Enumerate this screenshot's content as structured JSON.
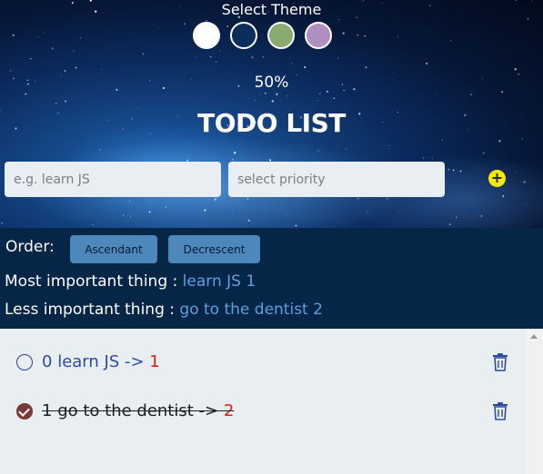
{
  "theme": {
    "title": "Select Theme",
    "swatches": [
      {
        "name": "white",
        "color": "#ffffff"
      },
      {
        "name": "navy",
        "color": "#0c2e5c"
      },
      {
        "name": "green",
        "color": "#8aab6e"
      },
      {
        "name": "purple",
        "color": "#b08fc0"
      }
    ]
  },
  "progress": {
    "label": "50%",
    "value": 50
  },
  "title": "TODO LIST",
  "form": {
    "task_placeholder": "e.g. learn JS",
    "priority_placeholder": "select priority",
    "add_icon": "+"
  },
  "order": {
    "label": "Order:",
    "asc_label": "Ascendant",
    "desc_label": "Decrescent"
  },
  "summary": {
    "most_label": "Most important thing :",
    "most_value": "learn JS 1",
    "less_label": "Less important thing :",
    "less_value": "go to the dentist 2"
  },
  "todos": [
    {
      "index": "0",
      "text": "learn JS",
      "arrow": "->",
      "priority": "1",
      "done": false
    },
    {
      "index": "1",
      "text": "go to the dentist",
      "arrow": "->",
      "priority": "2",
      "done": true
    }
  ],
  "colors": {
    "accent": "#4d88bd",
    "bar_bg": "#062648",
    "highlight": "#5f9edd",
    "priority": "#e01b0f",
    "add_button": "#f5e900"
  }
}
